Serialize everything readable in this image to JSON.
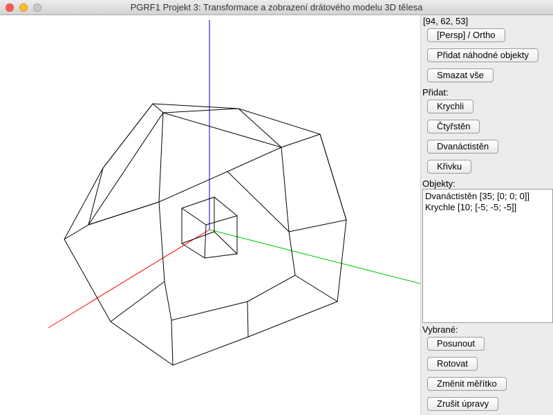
{
  "window": {
    "title": "PGRF1 Projekt 3: Transformace a zobrazení drátového modelu 3D tělesa"
  },
  "panel": {
    "coords": "[94, 62, 53]",
    "buttons": {
      "projection": "[Persp] / Ortho",
      "add_random": "Přidat náhodné objekty",
      "delete_all": "Smazat vše"
    },
    "add_label": "Přidat:",
    "add_buttons": {
      "cube": "Krychli",
      "tetrahedron": "Čtyřstěn",
      "dodecahedron": "Dvanáctistěn",
      "curve": "Křivku"
    },
    "objects_label": "Objekty:",
    "objects": [
      "Dvanáctistěn [35; [0; 0; 0]]",
      "Krychle [10; [-5; -5; -5]]"
    ],
    "selected_label": "Vybrané:",
    "selected_buttons": {
      "move": "Posunout",
      "rotate": "Rotovat",
      "scale": "Změnit měřítko",
      "reset": "Zrušit úpravy"
    }
  },
  "colors": {
    "axis_x": "#ff0000",
    "axis_y": "#00cc00",
    "axis_z": "#0000cc",
    "wireframe": "#000000"
  },
  "icons": [
    "close-icon",
    "minimize-icon",
    "zoom-icon"
  ]
}
